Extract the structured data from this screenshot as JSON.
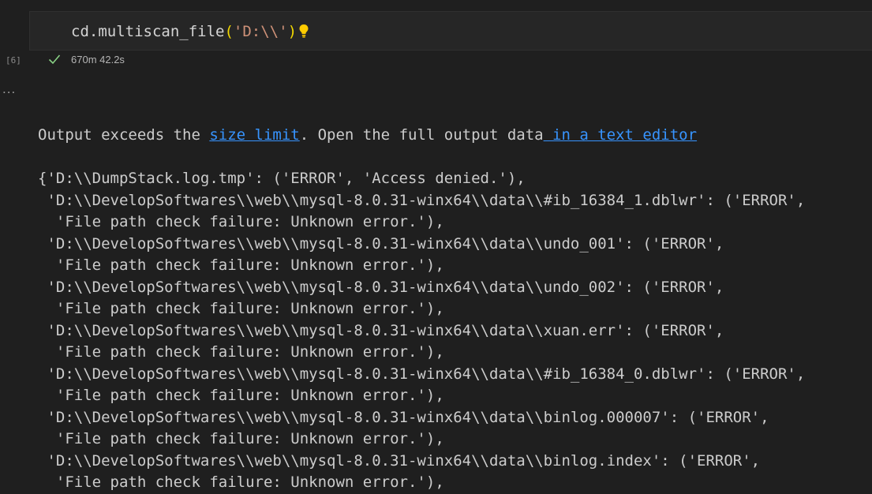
{
  "cell": {
    "code_prefix": "cd.multiscan_file",
    "code_open": "(",
    "code_arg": "'D:\\\\'",
    "code_close": ")",
    "execution_count": "[6]",
    "duration": "670m 42.2s",
    "status_icon": "check-icon",
    "hint_icon": "lightbulb-icon"
  },
  "output": {
    "more_label": "...",
    "notice_prefix": "Output exceeds the ",
    "notice_link1": "size limit",
    "notice_middle": ". Open the full output data",
    "notice_link2": " in a text editor",
    "lines": [
      "{'D:\\\\DumpStack.log.tmp': ('ERROR', 'Access denied.'),",
      " 'D:\\\\DevelopSoftwares\\\\web\\\\mysql-8.0.31-winx64\\\\data\\\\#ib_16384_1.dblwr': ('ERROR',",
      "  'File path check failure: Unknown error.'),",
      " 'D:\\\\DevelopSoftwares\\\\web\\\\mysql-8.0.31-winx64\\\\data\\\\undo_001': ('ERROR',",
      "  'File path check failure: Unknown error.'),",
      " 'D:\\\\DevelopSoftwares\\\\web\\\\mysql-8.0.31-winx64\\\\data\\\\undo_002': ('ERROR',",
      "  'File path check failure: Unknown error.'),",
      " 'D:\\\\DevelopSoftwares\\\\web\\\\mysql-8.0.31-winx64\\\\data\\\\xuan.err': ('ERROR',",
      "  'File path check failure: Unknown error.'),",
      " 'D:\\\\DevelopSoftwares\\\\web\\\\mysql-8.0.31-winx64\\\\data\\\\#ib_16384_0.dblwr': ('ERROR',",
      "  'File path check failure: Unknown error.'),",
      " 'D:\\\\DevelopSoftwares\\\\web\\\\mysql-8.0.31-winx64\\\\data\\\\binlog.000007': ('ERROR',",
      "  'File path check failure: Unknown error.'),",
      " 'D:\\\\DevelopSoftwares\\\\web\\\\mysql-8.0.31-winx64\\\\data\\\\binlog.index': ('ERROR',",
      "  'File path check failure: Unknown error.'),"
    ]
  }
}
